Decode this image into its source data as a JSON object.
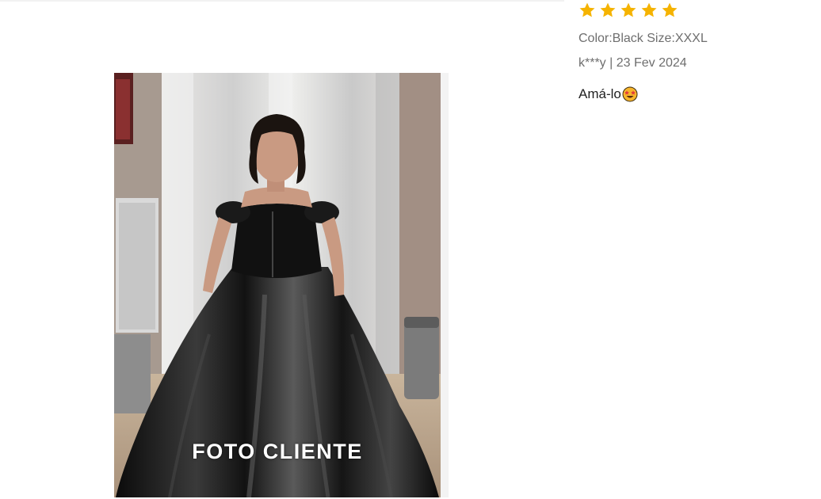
{
  "review": {
    "rating": 5,
    "rating_max": 5,
    "star_color": "#f5b301",
    "attributes": "Color:Black Size:XXXL",
    "author_date": "k***y | 23 Fev 2024",
    "text": "Amá-lo",
    "emoji_icon": "star-struck-emoji-icon"
  },
  "photo": {
    "caption": "FOTO CLIENTE"
  }
}
